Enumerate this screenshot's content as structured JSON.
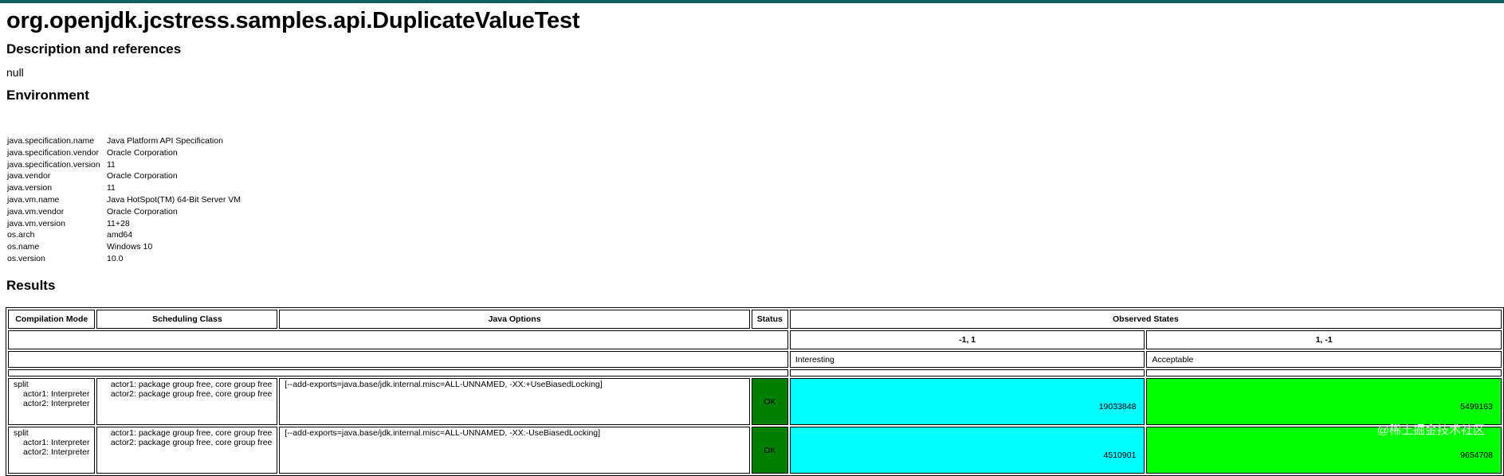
{
  "title": "org.openjdk.jcstress.samples.api.DuplicateValueTest",
  "sections": {
    "description": "Description and references",
    "environment": "Environment",
    "results": "Results"
  },
  "description_text": "null",
  "environment": [
    {
      "key": "java.specification.name",
      "value": "Java Platform API Specification"
    },
    {
      "key": "java.specification.vendor",
      "value": "Oracle Corporation"
    },
    {
      "key": "java.specification.version",
      "value": "11"
    },
    {
      "key": "java.vendor",
      "value": "Oracle Corporation"
    },
    {
      "key": "java.version",
      "value": "11"
    },
    {
      "key": "java.vm.name",
      "value": "Java HotSpot(TM) 64-Bit Server VM"
    },
    {
      "key": "java.vm.vendor",
      "value": "Oracle Corporation"
    },
    {
      "key": "java.vm.version",
      "value": "11+28"
    },
    {
      "key": "os.arch",
      "value": "amd64"
    },
    {
      "key": "os.name",
      "value": "Windows 10"
    },
    {
      "key": "os.version",
      "value": "10.0"
    }
  ],
  "results": {
    "headers": {
      "mode": "Compilation Mode",
      "scheduling": "Scheduling Class",
      "options": "Java Options",
      "status": "Status",
      "observed": "Observed States"
    },
    "states": [
      "-1, 1",
      "1, -1"
    ],
    "expectations": [
      "Interesting",
      "Acceptable"
    ],
    "colors": {
      "interesting": "#00ffff",
      "acceptable": "#00ff00",
      "ok": "#008000"
    },
    "rows": [
      {
        "mode": [
          "split",
          "actor1: Interpreter",
          "actor2: Interpreter"
        ],
        "scheduling": [
          "actor1: package group free, core group free",
          "actor2: package group free, core group free"
        ],
        "options": "[--add-exports=java.base/jdk.internal.misc=ALL-UNNAMED, -XX:+UseBiasedLocking]",
        "status": "OK",
        "counts": [
          "19033848",
          "5499163"
        ]
      },
      {
        "mode": [
          "split",
          "actor1: Interpreter",
          "actor2: Interpreter"
        ],
        "scheduling": [
          "actor1: package group free, core group free",
          "actor2: package group free, core group free"
        ],
        "options": "[--add-exports=java.base/jdk.internal.misc=ALL-UNNAMED, -XX:-UseBiasedLocking]",
        "status": "OK",
        "counts": [
          "4510901",
          "9654708"
        ]
      }
    ]
  },
  "watermark": "@稀土掘金技术社区"
}
